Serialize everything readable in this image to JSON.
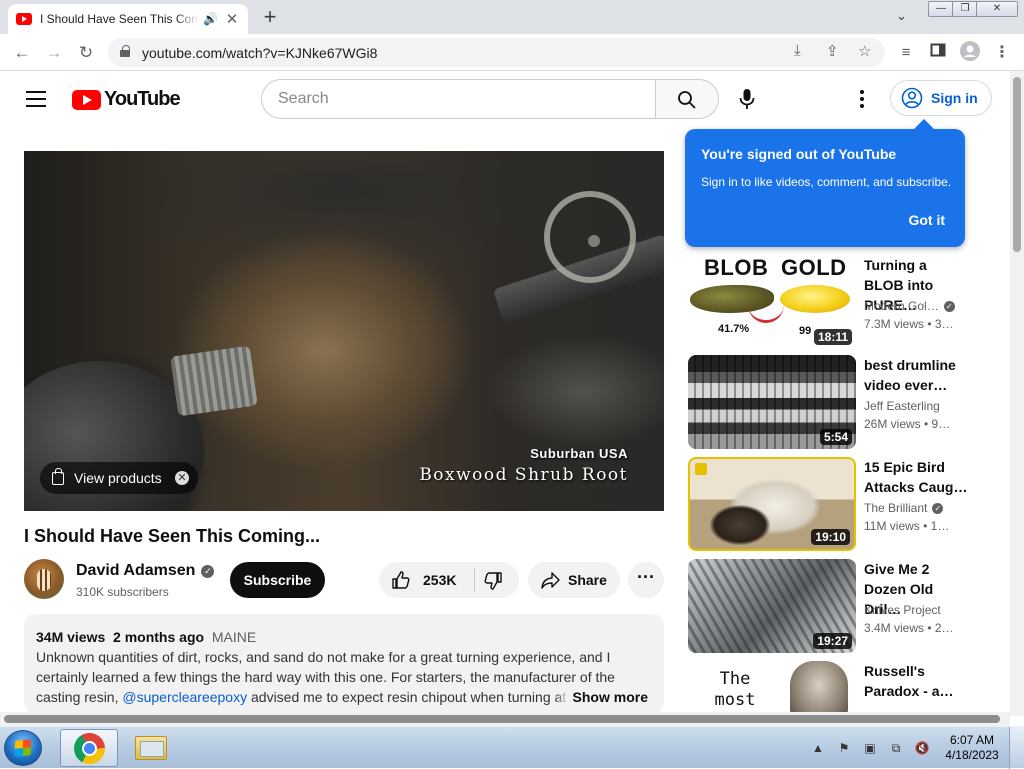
{
  "browser": {
    "tab_title": "I Should Have Seen This Coming...",
    "tab_speaker": "🔊",
    "tab_close": "✕",
    "new_tab": "+",
    "tab_search": "⌄",
    "url": "youtube.com/watch?v=KJNke67WGi8",
    "back": "←",
    "forward": "→",
    "reload": "↻",
    "window_min": "—",
    "window_max": "❐",
    "window_close": "✕"
  },
  "youtube": {
    "logo_text": "YouTube",
    "search_placeholder": "Search",
    "sign_in": "Sign in",
    "tooltip": {
      "title": "You're signed out of YouTube",
      "body": "Sign in to like videos, comment, and subscribe.",
      "button": "Got it"
    },
    "player": {
      "overlay_line1": "Suburban USA",
      "overlay_line2": "Boxwood Shrub Root",
      "view_products": "View products",
      "view_products_close": "✕"
    },
    "video": {
      "title": "I Should Have Seen This Coming...",
      "channel": "David Adamsen",
      "subscribers": "310K subscribers",
      "subscribe": "Subscribe",
      "likes": "253K",
      "share": "Share",
      "more": "···"
    },
    "description": {
      "views": "34M views",
      "age": "2 months ago",
      "location": "MAINE",
      "text_before": "Unknown quantities of dirt, rocks, and sand do not make for a great turning experience, and I certainly learned a few things the hard way with this one.  For starters, the manufacturer of the casting resin, ",
      "mention": "@supercleareepoxy",
      "text_after": "  advised me to expect resin chipout when turning at hi",
      "show_more": "Show more"
    },
    "recommendations": [
      {
        "title": "Turning a BLOB into PURE…",
        "channel": "Modern Gol…",
        "verified": true,
        "meta": "7.3M views  • 3…",
        "duration": "18:11",
        "thumb_big_1": "BLOB",
        "thumb_big_2": "GOLD",
        "thumb_pct_1": "41.7%",
        "thumb_pct_2": "99"
      },
      {
        "title": "best drumline video ever…",
        "channel": "Jeff Easterling",
        "verified": false,
        "meta": "26M views  • 9…",
        "duration": "5:54"
      },
      {
        "title": "15 Epic Bird Attacks Caug…",
        "channel": "The Brilliant",
        "verified": true,
        "meta": "11M views  • 1…",
        "duration": "19:10"
      },
      {
        "title": "Give Me 2 Dozen Old Dril…",
        "channel": "Knives Project",
        "verified": false,
        "meta": "3.4M views  • 2…",
        "duration": "19:27"
      },
      {
        "title": "Russell's Paradox - a…",
        "channel": "",
        "verified": false,
        "meta": "",
        "duration": "",
        "thumb_text": "The most Famous"
      }
    ]
  },
  "taskbar": {
    "time": "6:07 AM",
    "date": "4/18/2023"
  }
}
